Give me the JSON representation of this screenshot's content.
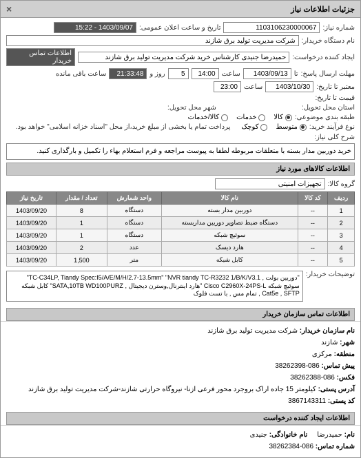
{
  "header": {
    "title": "جزئیات اطلاعات نیاز",
    "close": "×"
  },
  "fields": {
    "request_no_label": "شماره نیاز:",
    "request_no": "1103106230000067",
    "announce_label": "تاریخ و ساعت اعلان عمومی:",
    "announce_value": "1403/09/07 - 15:22",
    "buyer_name_label": "نام دستگاه خریدار:",
    "buyer_name": "شرکت مدیریت تولید برق شازند",
    "creator_label": "ایجاد کننده درخواست:",
    "creator": "حمیدرضا جنیدی کارشناس خرید شرکت مدیریت تولید برق شازند",
    "contact_label": "اطلاعات تماس خریدار",
    "deadline_label": "مهلت ارسال پاسخ:",
    "deadline_prefix": "تا",
    "deadline_date": "1403/09/13",
    "deadline_hour_label": "ساعت",
    "deadline_hour": "14:00",
    "deadline_remain_days": "5",
    "deadline_day_label": "روز و",
    "deadline_remain_time": "21:33:48",
    "deadline_remain_label": "ساعت باقی مانده",
    "valid_label": "معتبر تا تاریخ:",
    "valid_date": "1403/10/30",
    "valid_hour_label": "ساعت",
    "valid_hour": "23:00",
    "price_label": "قیمت تا تاریخ:",
    "delivery_label": "استان محل تحویل:",
    "delivery_city_label": "شهر محل تحویل:",
    "group_label": "طبقه بندی موضوعی:",
    "purchase_type_label": "نوع فرآیند خرید:",
    "payment_note_label": "پرداخت تمام یا بخشی از مبلغ خرید،از محل \"اسناد خزانه اسلامی\" خواهد بود.",
    "radio_kala": "کالا",
    "radio_khadamat": "خدمات",
    "radio_kala_khadamat": "کالا/خدمات",
    "radio_motavaset": "متوسط",
    "radio_koli": "کوچک"
  },
  "need_desc": {
    "label": "شرح کلی نیاز:",
    "text": "خرید دوربین مدار بسته با متعلقات مربوطه لطفا به پیوست مراجعه و فرم استعلام بهاء را تکمیل و بارگذاری کنید."
  },
  "goods_info_header": "اطلاعات کالاهای مورد نیاز",
  "goods_group": {
    "label": "گروه کالا:",
    "value": "تجهیزات امنیتی"
  },
  "table": {
    "headers": [
      "ردیف",
      "کد کالا",
      "نام کالا",
      "واحد شمارش",
      "تعداد / مقدار",
      "تاریخ نیاز"
    ],
    "rows": [
      [
        "1",
        "--",
        "دوربین مدار بسته",
        "دستگاه",
        "8",
        "1403/09/20"
      ],
      [
        "2",
        "--",
        "دستگاه ضبط تصاویر دوربین مداربسته",
        "دستگاه",
        "1",
        "1403/09/20"
      ],
      [
        "3",
        "--",
        "سوئیچ شبکه",
        "دستگاه",
        "1",
        "1403/09/20"
      ],
      [
        "4",
        "--",
        "هارد دیسک",
        "عدد",
        "2",
        "1403/09/20"
      ],
      [
        "5",
        "--",
        "کابل شبکه",
        "متر",
        "1,500",
        "1403/09/20"
      ]
    ]
  },
  "buyer_notes": {
    "label": "توضیحات خریدار:",
    "text": "\"دوربین بولت , TC-C34LP, Tiandy Spec:I5/A/E/M/H/2.7-13.5mm\" \"NVR tiandy TC-R3232 1/B/K/V3.1\" سوئیچ شبکه Cisco C2960X-24PS-L \"هارد اینترنال,وسترن دیجیتال , SATA,10TB WD100PURZ\" کابل شبکه Cat5e , SFTP , تمام مس , با تست فلوک"
  },
  "contact_info": {
    "header": "اطلاعات تماس سازمان خریدار",
    "org_label": "نام سازمان خریدار:",
    "org": "شرکت مدیریت تولید برق شازند",
    "city_label": "شهر:",
    "city": "شازند",
    "area_label": "منطقه:",
    "area": "مرکزی",
    "phone_label": "پیش تماس:",
    "phone": "086-38262398",
    "fax_label": "فکس:",
    "fax": "086-38262388",
    "address_label": "آدرس پستی:",
    "address": "کیلومتر 15 جاده اراک بروجرد محور فرعی ازنا- نیروگاه حرارتی شازند-شرکت مدیریت تولید برق شازند",
    "postal_label": "کد پستی:",
    "postal": "3867143311"
  },
  "creator_info": {
    "header": "اطلاعات ایجاد کننده درخواست",
    "name_label": "نام:",
    "name": "حمیدرضا",
    "family_label": "نام خانوادگی:",
    "family": "جنیدی",
    "phone_label": "شماره تماس:",
    "phone": "086-38262384"
  }
}
